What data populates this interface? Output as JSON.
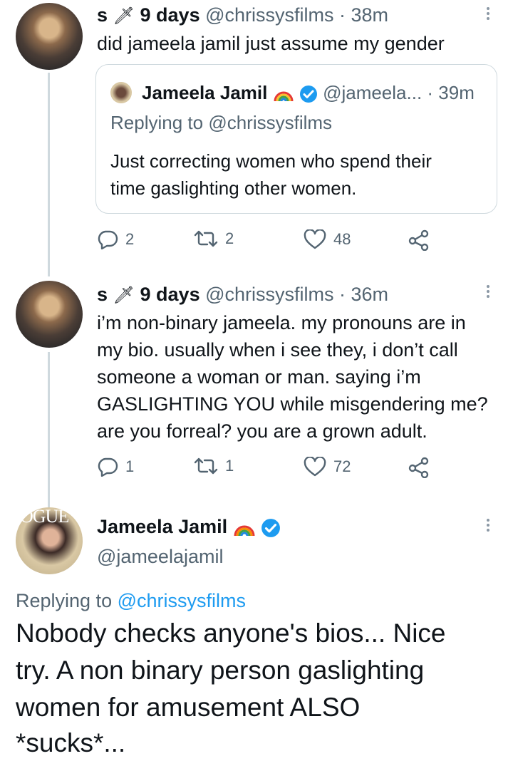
{
  "tweet1": {
    "name": "s",
    "emoji": "🗡",
    "display_suffix": "9 days",
    "handle": "@chrissysfilms",
    "time": "· 38m",
    "text": "did jameela jamil just assume my gender",
    "actions": {
      "reply": "2",
      "retweet": "2",
      "like": "48"
    }
  },
  "quote": {
    "name": "Jameela Jamil",
    "handle": "@jameela...",
    "time": "· 39m",
    "replying_prefix": "Replying to",
    "replying_handle": "@chrissysfilms",
    "text_lines": [
      "Just correcting women who spend their",
      "time gaslighting other women."
    ]
  },
  "tweet2": {
    "name": "s",
    "emoji": "🗡",
    "display_suffix": "9 days",
    "handle": "@chrissysfilms",
    "time": "· 36m",
    "text_lines": [
      "i’m non-binary jameela. my pronouns are in",
      "my bio. usually when i see they, i don’t call",
      "someone a woman or man. saying i’m",
      "GASLIGHTING YOU while misgendering me?",
      "are you forreal? you are a grown adult."
    ],
    "actions": {
      "reply": "1",
      "retweet": "1",
      "like": "72"
    }
  },
  "main_tweet": {
    "name": "Jameela Jamil",
    "handle": "@jameelajamil",
    "avatar_text": "OGUE",
    "replying_prefix": "Replying to",
    "replying_handle": "@chrissysfilms",
    "text_lines": [
      "Nobody checks anyone's bios... Nice",
      "try. A non binary person gaslighting",
      "women for amusement  ALSO",
      "*sucks*..."
    ]
  },
  "colors": {
    "link": "#1d9bf0",
    "muted": "#536471",
    "verified": "#1d9bf0",
    "border": "#cfd9de"
  },
  "icons": [
    "dagger-icon",
    "rainbow-icon",
    "verified-badge-icon",
    "more-icon",
    "reply-icon",
    "retweet-icon",
    "like-icon",
    "share-icon"
  ]
}
